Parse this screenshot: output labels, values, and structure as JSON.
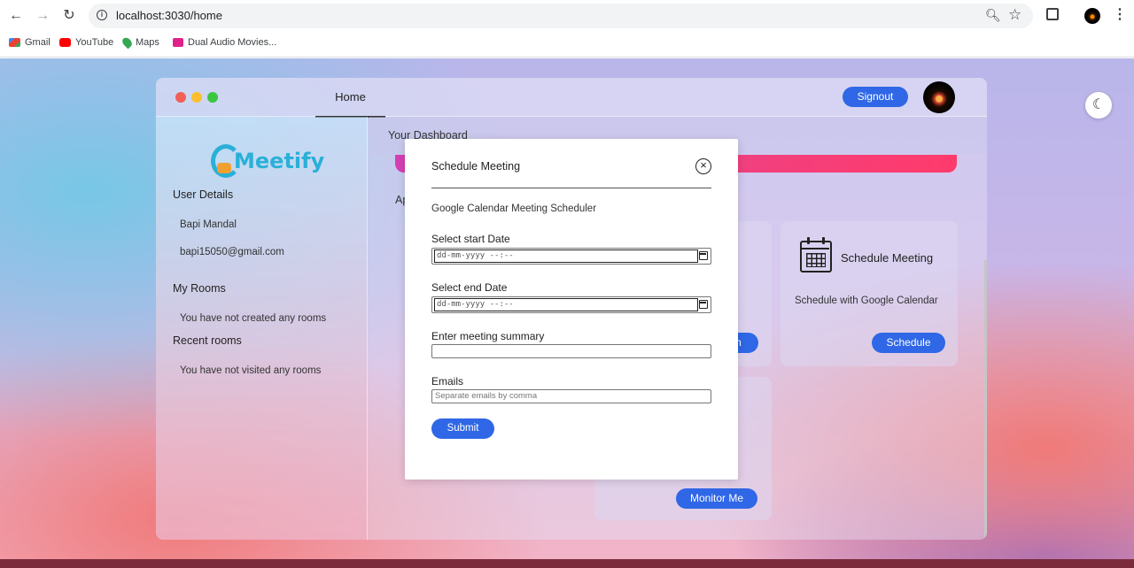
{
  "browser": {
    "url": "localhost:3030/home",
    "bookmarks": [
      {
        "label": "Gmail",
        "icon": "gmail-icon",
        "color": "#ea4335"
      },
      {
        "label": "YouTube",
        "icon": "youtube-icon",
        "color": "#ff0000"
      },
      {
        "label": "Maps",
        "icon": "maps-icon",
        "color": "#34a853"
      },
      {
        "label": "Dual Audio Movies...",
        "icon": "movies-icon",
        "color": "#e0218a"
      }
    ]
  },
  "app": {
    "nav": {
      "home_label": "Home",
      "signout_label": "Signout"
    },
    "logo_text": "Meetify",
    "sidebar": {
      "user_details_heading": "User Details",
      "user_name": "Bapi Mandal",
      "user_email": "bapi15050@gmail.com",
      "my_rooms_heading": "My Rooms",
      "my_rooms_empty": "You have not created any rooms",
      "recent_rooms_heading": "Recent rooms",
      "recent_rooms_empty": "You have not visited any rooms"
    },
    "dashboard": {
      "title": "Your Dashboard",
      "section_partial": "Ap",
      "partial_button_text": "n",
      "schedule_card": {
        "title": "Schedule Meeting",
        "description": "Schedule with Google Calendar",
        "button_label": "Schedule"
      },
      "monitor_card": {
        "button_label": "Monitor Me"
      }
    }
  },
  "modal": {
    "title": "Schedule Meeting",
    "subtitle": "Google Calendar Meeting Scheduler",
    "start_date_label": "Select start Date",
    "start_date_placeholder": "dd-mm-yyyy --:--",
    "end_date_label": "Select end Date",
    "end_date_placeholder": "dd-mm-yyyy --:--",
    "summary_label": "Enter meeting summary",
    "summary_value": "",
    "emails_label": "Emails",
    "emails_placeholder": "Separate emails by comma",
    "submit_label": "Submit"
  },
  "colors": {
    "accent": "#2f67e6",
    "banner": "#e8409a",
    "logo": "#2ab0d8"
  }
}
